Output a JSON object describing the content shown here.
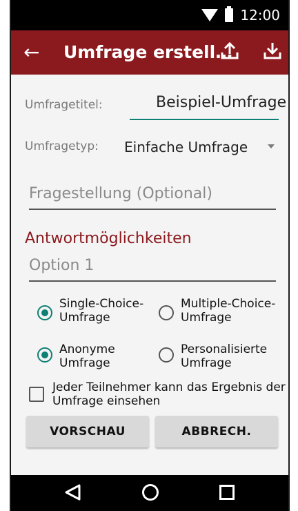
{
  "status": {
    "time": "12:00",
    "icons": [
      "wifi-icon",
      "battery-icon"
    ]
  },
  "appbar": {
    "title": "Umfrage erstell…",
    "actions": [
      "upload-icon",
      "download-icon"
    ]
  },
  "form": {
    "survey_title_label": "Umfragetitel:",
    "survey_title_value": "Beispiel-Umfrage",
    "survey_type_label": "Umfragetyp:",
    "survey_type_value": "Einfache Umfrage",
    "question_placeholder": "Fragestellung (Optional)",
    "answers_heading": "Antwortmöglichkeiten",
    "option1_placeholder": "Option 1"
  },
  "options": {
    "single_line1": "Single-Choice-",
    "single_line2": "Umfrage",
    "single_selected": true,
    "multiple_line1": "Multiple-Choice-",
    "multiple_line2": "Umfrage",
    "multiple_selected": false,
    "anonymous_line1": "Anonyme",
    "anonymous_line2": "Umfrage",
    "anonymous_selected": true,
    "personal_line1": "Personalisierte",
    "personal_line2": "Umfrage",
    "personal_selected": false,
    "visibility_line1": "Jeder Teilnehmer kann das Ergebnis der",
    "visibility_line2": "Umfrage einsehen",
    "visibility_checked": false
  },
  "buttons": {
    "preview": "VORSCHAU",
    "cancel": "ABBRECH."
  },
  "colors": {
    "primary": "#8b1a1e",
    "accent": "#0d7f74",
    "background": "#f4f4f4"
  }
}
